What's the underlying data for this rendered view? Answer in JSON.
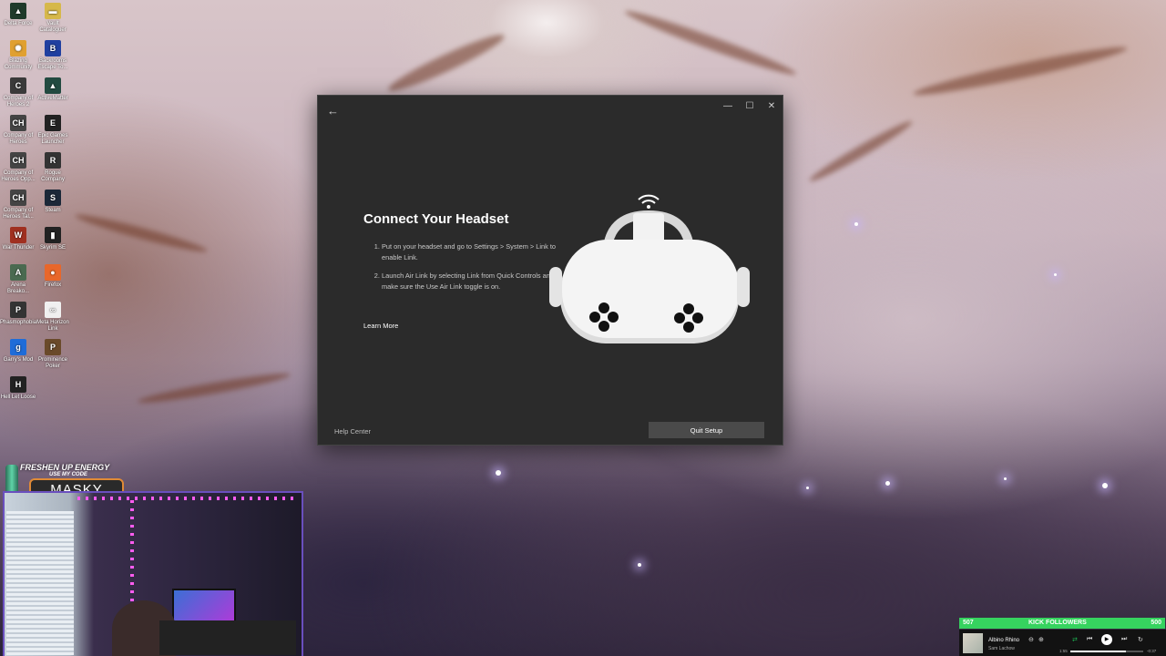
{
  "desktop": {
    "icons": [
      {
        "label": "Delta Force",
        "glyph": "▲",
        "color": "#1f3a2a"
      },
      {
        "label": "Vault Cataloguer",
        "glyph": "▬",
        "color": "#d6b84a"
      },
      {
        "label": "Blazing Community",
        "glyph": "✺",
        "color": "#e0a030"
      },
      {
        "label": "Backrooms Escape To...",
        "glyph": "B",
        "color": "#2040a0"
      },
      {
        "label": "Company of Heroes 2",
        "glyph": "C",
        "color": "#3a3a3a"
      },
      {
        "label": "ActiveMatter",
        "glyph": "▲",
        "color": "#224a40"
      },
      {
        "label": "Company of Heroes",
        "glyph": "CH",
        "color": "#444"
      },
      {
        "label": "Epic Games Launcher",
        "glyph": "E",
        "color": "#222"
      },
      {
        "label": "Company of Heroes Opp...",
        "glyph": "CH",
        "color": "#444"
      },
      {
        "label": "Rogue Company",
        "glyph": "R",
        "color": "#333"
      },
      {
        "label": "Company of Heroes Tal...",
        "glyph": "CH",
        "color": "#444"
      },
      {
        "label": "Steam",
        "glyph": "S",
        "color": "#1b2838"
      },
      {
        "label": "War Thunder",
        "glyph": "W",
        "color": "#a03020"
      },
      {
        "label": "Skyrim SE",
        "glyph": "▮",
        "color": "#222"
      },
      {
        "label": "Arena Breako...",
        "glyph": "A",
        "color": "#4a6a50"
      },
      {
        "label": "Firefox",
        "glyph": "●",
        "color": "#e8672a"
      },
      {
        "label": "Phasmophobia",
        "glyph": "P",
        "color": "#333"
      },
      {
        "label": "Meta Horizon Link",
        "glyph": "∞",
        "color": "#f0f0f0"
      },
      {
        "label": "Garry's Mod",
        "glyph": "g",
        "color": "#1e6cd8"
      },
      {
        "label": "Prominence Poker",
        "glyph": "P",
        "color": "#6a4a2a"
      },
      {
        "label": "Hell Let Loose",
        "glyph": "H",
        "color": "#222"
      }
    ]
  },
  "window": {
    "back_icon": "←",
    "minimize": "—",
    "maximize": "☐",
    "close": "✕",
    "title": "Connect Your Headset",
    "steps": [
      "Put on your headset and go to Settings > System > Link to enable Link.",
      "Launch Air Link by selecting Link from Quick Controls and make sure the Use Air Link toggle is on."
    ],
    "learn_more": "Learn More",
    "help_center": "Help Center",
    "quit_setup": "Quit Setup"
  },
  "overlay": {
    "promo_title": "FRESHEN UP ENERGY",
    "promo_sub": "USE MY CODE",
    "promo_code": "MASKY"
  },
  "followers": {
    "current": "507",
    "label": "KICK FOLLOWERS",
    "goal": "500"
  },
  "player": {
    "song": "Albino Rhino",
    "artist": "Sam Lachow",
    "elapsed": "1:55",
    "remaining": "-0:37",
    "progress": 0.76
  }
}
